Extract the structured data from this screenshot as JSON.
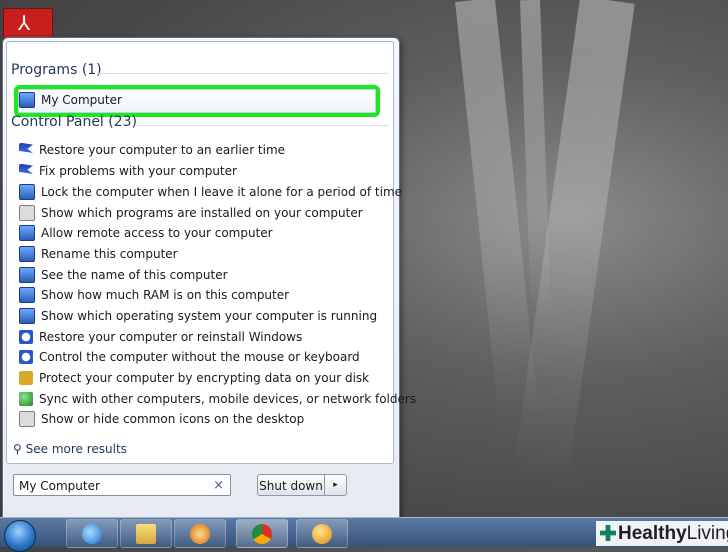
{
  "programs": {
    "header": "Programs (1)",
    "items": [
      {
        "label": "My Computer",
        "icon": "computer-icon"
      }
    ]
  },
  "control_panel": {
    "header": "Control Panel (23)",
    "items": [
      {
        "label": "Restore your computer to an earlier time",
        "icon": "flag-icon"
      },
      {
        "label": "Fix problems with your computer",
        "icon": "flag-icon"
      },
      {
        "label": "Lock the computer when I leave it alone for a period of time",
        "icon": "monitor-icon"
      },
      {
        "label": "Show which programs are installed on your computer",
        "icon": "programs-icon"
      },
      {
        "label": "Allow remote access to your computer",
        "icon": "monitor-icon"
      },
      {
        "label": "Rename this computer",
        "icon": "monitor-icon"
      },
      {
        "label": "See the name of this computer",
        "icon": "monitor-icon"
      },
      {
        "label": "Show how much RAM is on this computer",
        "icon": "monitor-icon"
      },
      {
        "label": "Show which operating system your computer is running",
        "icon": "monitor-icon"
      },
      {
        "label": "Restore your computer or reinstall Windows",
        "icon": "recovery-icon"
      },
      {
        "label": "Control the computer without the mouse or keyboard",
        "icon": "ease-of-access-icon"
      },
      {
        "label": "Protect your computer by encrypting data on your disk",
        "icon": "key-icon"
      },
      {
        "label": "Sync with other computers, mobile devices, or network folders",
        "icon": "sync-icon"
      },
      {
        "label": "Show or hide common icons on the desktop",
        "icon": "display-icon"
      }
    ]
  },
  "see_more": "See more results",
  "search": {
    "value": "My Computer",
    "clear": "×"
  },
  "shutdown": {
    "label": "Shut down",
    "arrow": "▸"
  },
  "watermark": {
    "bold": "Healthy",
    "light": "Living"
  },
  "colors": {
    "highlight": "#1fe71f",
    "header_text": "#1e395b"
  }
}
